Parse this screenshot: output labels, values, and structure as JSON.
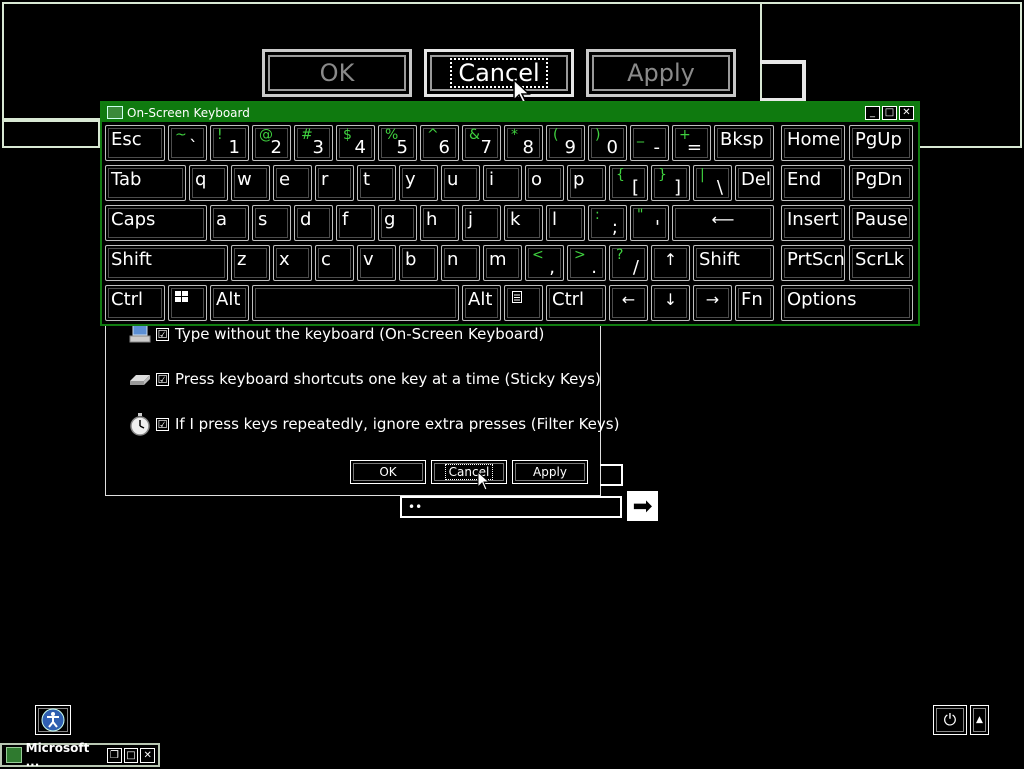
{
  "magnified": {
    "buttons": {
      "ok": "OK",
      "cancel": "Cancel",
      "apply": "Apply"
    }
  },
  "ease_dialog": {
    "options": [
      {
        "label": "Type without the keyboard (On-Screen Keyboard)",
        "checked": true,
        "icon": "keyboard-monitor-icon"
      },
      {
        "label": "Press keyboard shortcuts one key at a time (Sticky Keys)",
        "checked": true,
        "icon": "sticky-key-icon"
      },
      {
        "label": "If I press keys repeatedly, ignore extra presses (Filter Keys)",
        "checked": true,
        "icon": "stopwatch-icon"
      }
    ],
    "buttons": {
      "ok": "OK",
      "cancel": "Cancel",
      "apply": "Apply"
    },
    "password_value": "••",
    "check_mark": "☑"
  },
  "osk": {
    "title": "On-Screen Keyboard",
    "title_buttons": {
      "minimize": "_",
      "maximize": "□",
      "close": "✕"
    },
    "keys": {
      "esc": "Esc",
      "r1": [
        {
          "shift": "~",
          "base": "`"
        },
        {
          "shift": "!",
          "base": "1"
        },
        {
          "shift": "@",
          "base": "2"
        },
        {
          "shift": "#",
          "base": "3"
        },
        {
          "shift": "$",
          "base": "4"
        },
        {
          "shift": "%",
          "base": "5"
        },
        {
          "shift": "^",
          "base": "6"
        },
        {
          "shift": "&",
          "base": "7"
        },
        {
          "shift": "*",
          "base": "8"
        },
        {
          "shift": "(",
          "base": "9"
        },
        {
          "shift": ")",
          "base": "0"
        },
        {
          "shift": "_",
          "base": "-"
        },
        {
          "shift": "+",
          "base": "="
        }
      ],
      "bksp": "Bksp",
      "home": "Home",
      "pgup": "PgUp",
      "tab": "Tab",
      "r2": [
        "q",
        "w",
        "e",
        "r",
        "t",
        "y",
        "u",
        "i",
        "o",
        "p"
      ],
      "r2_brackets": [
        {
          "shift": "{",
          "base": "["
        },
        {
          "shift": "}",
          "base": "]"
        },
        {
          "shift": "|",
          "base": "\\"
        }
      ],
      "del": "Del",
      "end": "End",
      "pgdn": "PgDn",
      "caps": "Caps",
      "r3": [
        "a",
        "s",
        "d",
        "f",
        "g",
        "h",
        "j",
        "k",
        "l"
      ],
      "r3_punct": [
        {
          "shift": ":",
          "base": ";"
        },
        {
          "shift": "\"",
          "base": "'"
        }
      ],
      "enter_glyph": "⟵",
      "insert": "Insert",
      "pause": "Pause",
      "shift": "Shift",
      "r4": [
        "z",
        "x",
        "c",
        "v",
        "b",
        "n",
        "m"
      ],
      "r4_punct": [
        {
          "shift": "<",
          "base": ","
        },
        {
          "shift": ">",
          "base": "."
        },
        {
          "shift": "?",
          "base": "/"
        }
      ],
      "up_arrow": "↑",
      "shift_right": "Shift",
      "prtscn": "PrtScn",
      "scrlk": "ScrLk",
      "ctrl": "Ctrl",
      "alt": "Alt",
      "alt_right": "Alt",
      "ctrl_right": "Ctrl",
      "left_arrow": "←",
      "down_arrow": "↓",
      "right_arrow": "→",
      "fn": "Fn",
      "options": "Options"
    }
  },
  "taskbar": {
    "app_label": "Microsoft ...",
    "go_arrow": "➡",
    "power_glyph": "⏻",
    "scroll_up_glyph": "▲"
  },
  "colors": {
    "accent_green": "#107c10",
    "shift_label_green": "#3fd13f"
  }
}
